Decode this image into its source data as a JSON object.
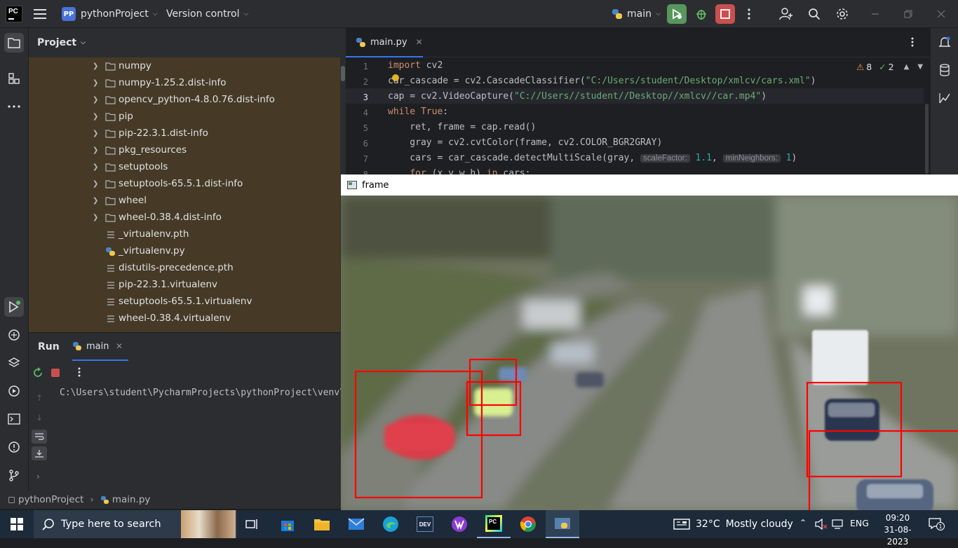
{
  "titlebar": {
    "project_badge": "PP",
    "project_name": "pythonProject",
    "vcs": "Version control",
    "run_config": "main"
  },
  "project_panel": {
    "title": "Project",
    "items": [
      {
        "label": "numpy",
        "type": "folder"
      },
      {
        "label": "numpy-1.25.2.dist-info",
        "type": "folder"
      },
      {
        "label": "opencv_python-4.8.0.76.dist-info",
        "type": "folder"
      },
      {
        "label": "pip",
        "type": "folder"
      },
      {
        "label": "pip-22.3.1.dist-info",
        "type": "folder"
      },
      {
        "label": "pkg_resources",
        "type": "folder"
      },
      {
        "label": "setuptools",
        "type": "folder"
      },
      {
        "label": "setuptools-65.5.1.dist-info",
        "type": "folder"
      },
      {
        "label": "wheel",
        "type": "folder"
      },
      {
        "label": "wheel-0.38.4.dist-info",
        "type": "folder"
      },
      {
        "label": "_virtualenv.pth",
        "type": "file"
      },
      {
        "label": "_virtualenv.py",
        "type": "python"
      },
      {
        "label": "distutils-precedence.pth",
        "type": "file"
      },
      {
        "label": "pip-22.3.1.virtualenv",
        "type": "file"
      },
      {
        "label": "setuptools-65.5.1.virtualenv",
        "type": "file"
      },
      {
        "label": "wheel-0.38.4.virtualenv",
        "type": "file"
      }
    ]
  },
  "editor": {
    "tab_label": "main.py",
    "warnings": "8",
    "weak_warnings": "2",
    "lines": [
      {
        "n": "1",
        "html": "<span class='kw'>import</span> cv2"
      },
      {
        "n": "2",
        "html": "car_cascade = cv2.CascadeClassifier(<span class='str'>\"C:/Users/student/Desktop/xmlcv/cars.xml\"</span>)"
      },
      {
        "n": "3",
        "html": "cap = cv2.VideoCapture(<span class='str'>\"C://Users//student//Desktop//xmlcv//car.mp4\"</span>)"
      },
      {
        "n": "4",
        "html": "<span class='kw'>while</span> <span class='kw'>True</span>:"
      },
      {
        "n": "5",
        "html": "    ret, frame = cap.read()"
      },
      {
        "n": "6",
        "html": "    gray = cv2.cvtColor(frame, cv2.COLOR_BGR2GRAY)"
      },
      {
        "n": "7",
        "html": "    cars = car_cascade.detectMultiScale(gray, <span class='hint'>scaleFactor:</span> <span class='num'>1.1</span>, <span class='hint'>minNeighbors:</span> <span class='num'>1</span>)"
      },
      {
        "n": "8",
        "html": "    <span class='kw'>for</span> (x,y,w,h) <span class='kw'>in</span> cars:"
      }
    ]
  },
  "run_panel": {
    "tab_run": "Run",
    "tab_main": "main",
    "console_line": "C:\\Users\\student\\PycharmProjects\\pythonProject\\venv\\Scripts\\python.exe"
  },
  "statusbar": {
    "project": "pythonProject",
    "file": "main.py"
  },
  "frame_window": {
    "title": "frame"
  },
  "taskbar": {
    "search_placeholder": "Type here to search",
    "temperature": "32°C",
    "weather": "Mostly cloudy",
    "language": "ENG",
    "time": "09:20",
    "date": "31-08-2023",
    "notifications": "1"
  }
}
